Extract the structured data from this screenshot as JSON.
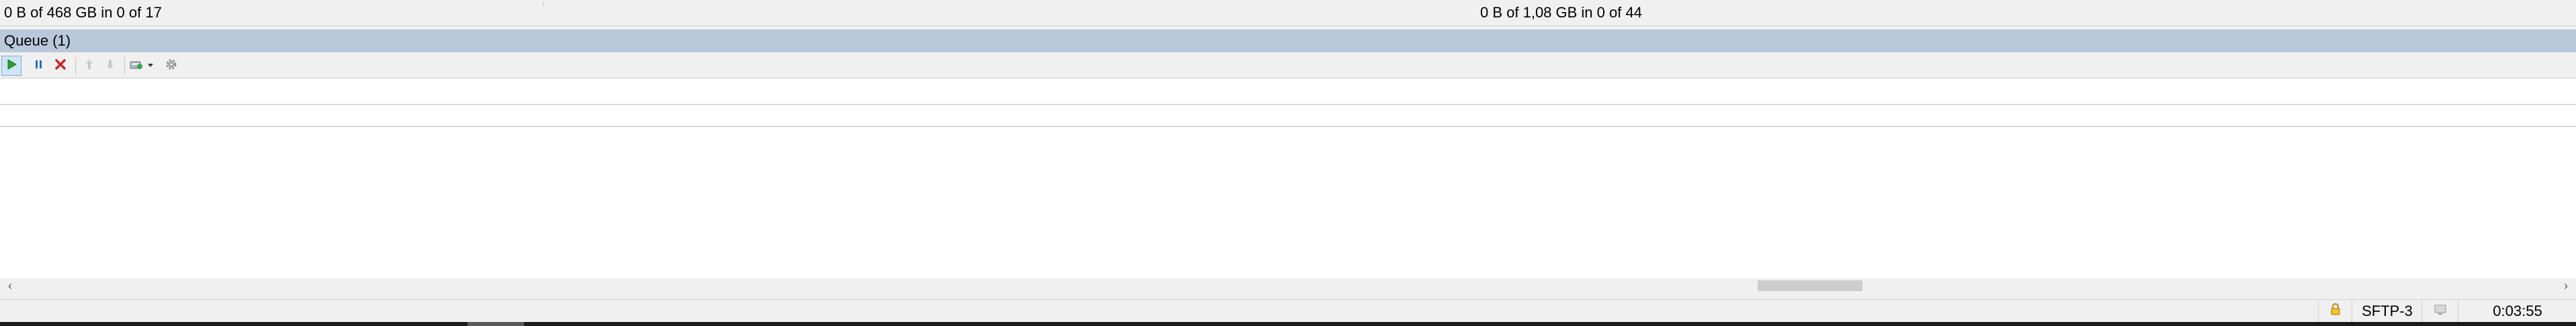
{
  "transfer_summary": {
    "local": "0 B of 468 GB in 0 of 17",
    "remote": "0 B of 1,08 GB in 0 of 44"
  },
  "queue": {
    "title": "Queue (1)"
  },
  "toolbar": {
    "buttons": [
      "play-icon",
      "pause-icon",
      "cancel-icon",
      "move-up-icon",
      "move-down-icon",
      "queue-settings-icon",
      "dropdown-arrow-icon",
      "gear-icon"
    ]
  },
  "status_bar": {
    "lock_icon": "lock-icon",
    "protocol": "SFTP-3",
    "monitor_icon": "monitor-icon",
    "elapsed": "0:03:55"
  },
  "colors": {
    "queue_header": "#b9c9db",
    "play": "#2e9e2e",
    "pause": "#2d6fb3",
    "cancel": "#c62828"
  }
}
